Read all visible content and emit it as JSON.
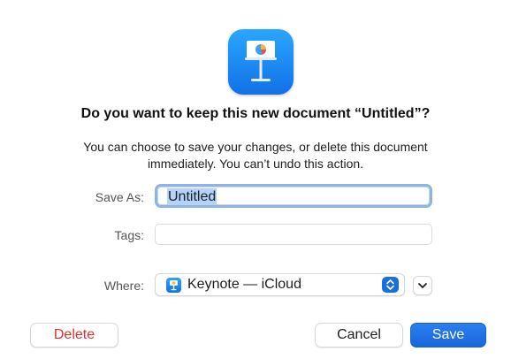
{
  "dialog": {
    "title": "Do you want to keep this new document “Untitled”?",
    "message": "You can choose to save your changes, or delete this document immediately. You can’t undo this action.",
    "app_icon": "keynote-app-icon"
  },
  "form": {
    "save_as_label": "Save As:",
    "save_as_value": "Untitled",
    "tags_label": "Tags:",
    "tags_value": "",
    "where_label": "Where:",
    "where_value": "Keynote — iCloud",
    "where_icon": "keynote-app-icon"
  },
  "buttons": {
    "delete_label": "Delete",
    "cancel_label": "Cancel",
    "save_label": "Save"
  },
  "colors": {
    "accent": "#1a6fe0",
    "delete_text": "#e0302a",
    "focus_ring": "#8eb3e6",
    "selection": "#b3d3fb"
  }
}
